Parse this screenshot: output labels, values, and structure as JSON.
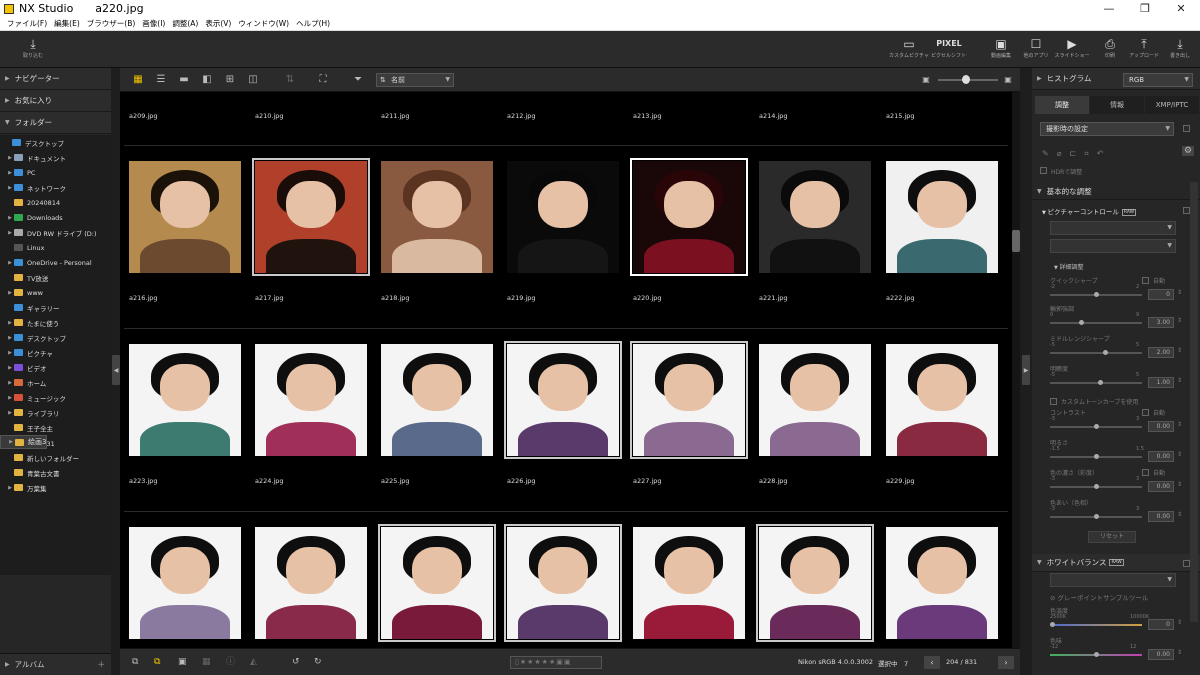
{
  "window": {
    "app_name": "NX Studio",
    "file_name": "a220.jpg"
  },
  "menu": [
    "ファイル(F)",
    "編集(E)",
    "ブラウザー(B)",
    "画像(I)",
    "調整(A)",
    "表示(V)",
    "ウィンドウ(W)",
    "ヘルプ(H)"
  ],
  "toolbar": {
    "import": {
      "label": "取り込む",
      "icon": "import-icon"
    },
    "right": [
      {
        "label": "カスタムピクチャーコントロール",
        "icon": "picture-control-icon"
      },
      {
        "label": "ピクセルシフト合成",
        "icon": "pixel-shift-icon",
        "glyph": "PIXEL"
      },
      {
        "label": "動画編集",
        "icon": "movie-edit-icon"
      },
      {
        "label": "他のアプリ",
        "icon": "other-apps-icon"
      },
      {
        "label": "スライドショー",
        "icon": "slideshow-icon"
      },
      {
        "label": "印刷",
        "icon": "print-icon"
      },
      {
        "label": "アップロード",
        "icon": "upload-icon"
      },
      {
        "label": "書き出し",
        "icon": "export-icon"
      }
    ]
  },
  "left": {
    "navigator": "ナビゲーター",
    "favorites": "お気に入り",
    "folders": "フォルダー",
    "album": "アルバム",
    "tree": [
      {
        "label": "デスクトップ",
        "depth": 0,
        "exp": "",
        "color": "#3a8fd6"
      },
      {
        "label": "ドキュメント",
        "depth": 1,
        "exp": "▶",
        "color": "#8aa0b8"
      },
      {
        "label": "PC",
        "depth": 1,
        "exp": "▶",
        "color": "#3a8fd6"
      },
      {
        "label": "ネットワーク",
        "depth": 1,
        "exp": "▶",
        "color": "#3a8fd6"
      },
      {
        "label": "20240814",
        "depth": 1,
        "exp": "",
        "color": "#e3b341"
      },
      {
        "label": "Downloads",
        "depth": 1,
        "exp": "▶",
        "color": "#2fa84f"
      },
      {
        "label": "DVD RW ドライブ (D:)",
        "depth": 1,
        "exp": "▶",
        "color": "#aaaaaa"
      },
      {
        "label": "Linux",
        "depth": 1,
        "exp": "",
        "color": "#555555"
      },
      {
        "label": "OneDrive - Personal",
        "depth": 1,
        "exp": "▶",
        "color": "#3a8fd6"
      },
      {
        "label": "TV放送",
        "depth": 1,
        "exp": "",
        "color": "#e3b341"
      },
      {
        "label": "www",
        "depth": 1,
        "exp": "▶",
        "color": "#e3b341"
      },
      {
        "label": "ギャラリー",
        "depth": 1,
        "exp": "",
        "color": "#3a8fd6"
      },
      {
        "label": "たまに使う",
        "depth": 1,
        "exp": "▶",
        "color": "#e3b341"
      },
      {
        "label": "デスクトップ",
        "depth": 1,
        "exp": "▶",
        "color": "#3a8fd6"
      },
      {
        "label": "ピクチャ",
        "depth": 1,
        "exp": "▶",
        "color": "#3a8fd6"
      },
      {
        "label": "ビデオ",
        "depth": 1,
        "exp": "▶",
        "color": "#7b4fd6"
      },
      {
        "label": "ホーム",
        "depth": 1,
        "exp": "▶",
        "color": "#d66a3a"
      },
      {
        "label": "ミュージック",
        "depth": 1,
        "exp": "▶",
        "color": "#d6503a"
      },
      {
        "label": "ライブラリ",
        "depth": 1,
        "exp": "▶",
        "color": "#e3b341"
      },
      {
        "label": "王子全主",
        "depth": 1,
        "exp": "",
        "color": "#e3b341"
      },
      {
        "label": "絵画3",
        "depth": 1,
        "exp": "▶",
        "color": "#e3b341",
        "selected": true
      },
      {
        "label": "雑文書31",
        "depth": 1,
        "exp": "",
        "color": "#e3b341"
      },
      {
        "label": "新しいフォルダー",
        "depth": 1,
        "exp": "",
        "color": "#e3b341"
      },
      {
        "label": "青葉古文書",
        "depth": 1,
        "exp": "",
        "color": "#e3b341"
      },
      {
        "label": "万葉集",
        "depth": 1,
        "exp": "▶",
        "color": "#e3b341"
      }
    ]
  },
  "view": {
    "sort_label": "名前"
  },
  "grid": {
    "top_labels": [
      "a209.jpg",
      "a210.jpg",
      "a211.jpg",
      "a212.jpg",
      "a213.jpg",
      "a214.jpg",
      "a215.jpg"
    ],
    "rows": [
      [
        {
          "label": "a216.jpg",
          "bg": "#b48a4e",
          "hair": "#1a1208",
          "torso": "#6b4a30",
          "frame": ""
        },
        {
          "label": "a217.jpg",
          "bg": "#b0402a",
          "hair": "#1a0c08",
          "torso": "#20120c",
          "frame": "frm"
        },
        {
          "label": "a218.jpg",
          "bg": "#8a5a40",
          "hair": "#5a3420",
          "torso": "#d9b9a0",
          "frame": ""
        },
        {
          "label": "a219.jpg",
          "bg": "#0a0a0a",
          "hair": "#080808",
          "torso": "#151515",
          "frame": ""
        },
        {
          "label": "a220.jpg",
          "bg": "#1a0808",
          "hair": "#2a0508",
          "torso": "#7a1020",
          "frame": "cur"
        },
        {
          "label": "a221.jpg",
          "bg": "#2a2a2a",
          "hair": "#0a0a0a",
          "torso": "#111111",
          "frame": ""
        },
        {
          "label": "a222.jpg",
          "bg": "#f0f0f0",
          "hair": "#0e0e0e",
          "torso": "#3a6a70",
          "frame": ""
        }
      ],
      [
        {
          "label": "a223.jpg",
          "bg": "#f4f4f4",
          "hair": "#0e0e0e",
          "torso": "#3d7a70",
          "frame": ""
        },
        {
          "label": "a224.jpg",
          "bg": "#f4f4f4",
          "hair": "#0e0e0e",
          "torso": "#a0305a",
          "frame": ""
        },
        {
          "label": "a225.jpg",
          "bg": "#f4f4f4",
          "hair": "#0e0e0e",
          "torso": "#5a6a8a",
          "frame": ""
        },
        {
          "label": "a226.jpg",
          "bg": "#f4f4f4",
          "hair": "#0e0e0e",
          "torso": "#5a3a6a",
          "frame": "frm"
        },
        {
          "label": "a227.jpg",
          "bg": "#f4f4f4",
          "hair": "#0e0e0e",
          "torso": "#8a6a90",
          "frame": "frm"
        },
        {
          "label": "a228.jpg",
          "bg": "#f4f4f4",
          "hair": "#0e0e0e",
          "torso": "#8a6a90",
          "frame": ""
        },
        {
          "label": "a229.jpg",
          "bg": "#f4f4f4",
          "hair": "#0e0e0e",
          "torso": "#8a2a40",
          "frame": ""
        }
      ],
      [
        {
          "label": "",
          "bg": "#f4f4f4",
          "hair": "#0e0e0e",
          "torso": "#8a7aa0",
          "frame": ""
        },
        {
          "label": "",
          "bg": "#f4f4f4",
          "hair": "#0e0e0e",
          "torso": "#8a2a4a",
          "frame": ""
        },
        {
          "label": "",
          "bg": "#f4f4f4",
          "hair": "#0e0e0e",
          "torso": "#7a1a3a",
          "frame": "frm"
        },
        {
          "label": "",
          "bg": "#f4f4f4",
          "hair": "#0e0e0e",
          "torso": "#5a3a6a",
          "frame": "frm"
        },
        {
          "label": "",
          "bg": "#f4f4f4",
          "hair": "#0e0e0e",
          "torso": "#9a1a3a",
          "frame": ""
        },
        {
          "label": "",
          "bg": "#f4f4f4",
          "hair": "#0e0e0e",
          "torso": "#6a2a5a",
          "frame": "frm"
        },
        {
          "label": "",
          "bg": "#f4f4f4",
          "hair": "#0e0e0e",
          "torso": "#6a3a7a",
          "frame": ""
        }
      ]
    ]
  },
  "status": {
    "profile": "Nikon sRGB 4.0.0.3002",
    "sel_label": "選択中",
    "sel_count": "7",
    "page": "204 / 831"
  },
  "right": {
    "histogram": "ヒストグラム",
    "hist_mode": "RGB",
    "tabs": [
      "調整",
      "情報",
      "XMP/IPTC"
    ],
    "preset": "撮影時の設定",
    "hdr": "HDRで調整",
    "basic": "基本的な調整",
    "pc": "ピクチャーコントロール",
    "badge": "RAW",
    "detail": "詳細調整",
    "auto": "自動",
    "quick_sharp": "クイックシャープ",
    "outline": "輪郭強調",
    "mid_sharp": "ミドルレンジシャープ",
    "clarity": "明瞭度",
    "custom_curve": "カスタムトーンカーブを使用",
    "contrast": "コントラスト",
    "brightness": "明るさ",
    "saturation": "色の濃さ（彩度）",
    "hue": "色あい（色相）",
    "reset": "リセット",
    "wb": "ホワイトバランス",
    "gray_tool": "グレーポイントサンプルツール",
    "temp": "色温度",
    "tint": "色味",
    "vals": {
      "qs": "0",
      "ol": "3.00",
      "ms": "2.00",
      "cl": "1.00",
      "co": "0.00",
      "br": "0.00",
      "sa": "0.00",
      "hu": "0.00",
      "wb1": "0",
      "wb2": "0.00"
    },
    "ticks": {
      "m2": "-2",
      "p2": "2",
      "z": "0",
      "n9": "9",
      "m5": "-5",
      "p5": "5",
      "m3": "-3",
      "p3": "3",
      "m15": "-1.5",
      "p15": "1.5",
      "t1": "2500K",
      "t2": "10000K",
      "m12": "-12",
      "p12": "12"
    }
  }
}
